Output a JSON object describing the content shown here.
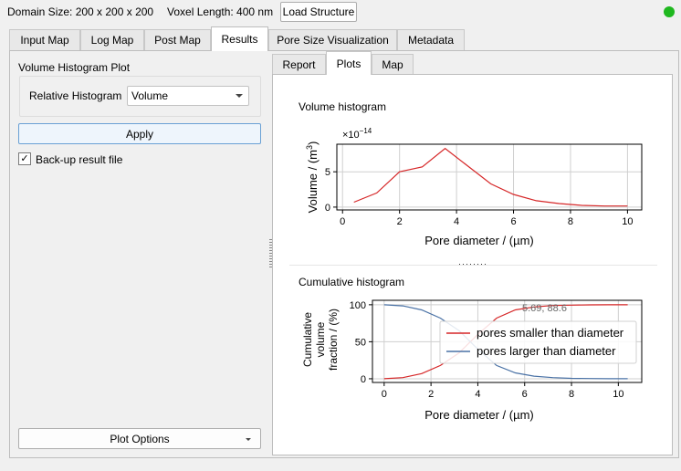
{
  "topbar": {
    "domain_size": "Domain Size: 200 x 200 x 200",
    "voxel_length": "Voxel Length: 400 nm",
    "load_button": "Load Structure",
    "status_color": "#1fb81f"
  },
  "tabs": [
    "Input Map",
    "Log Map",
    "Post Map",
    "Results",
    "Pore Size Visualization",
    "Metadata"
  ],
  "active_tab": "Results",
  "left": {
    "section_title": "Volume Histogram Plot",
    "relative_label": "Relative Histogram",
    "relative_value": "Volume",
    "apply_button": "Apply",
    "backup_checked": true,
    "backup_check_glyph": "✓",
    "backup_label": "Back-up result file",
    "plot_options_button": "Plot Options"
  },
  "subtabs": [
    "Report",
    "Plots",
    "Map"
  ],
  "active_subtab": "Plots",
  "hsplit_dots": "........",
  "chart_data": [
    {
      "type": "line",
      "title": "Volume histogram",
      "xlabel": "Pore diameter / (µm)",
      "ylabel": "Volume / (m³)",
      "ylabel_parts": [
        "Volume / (m",
        "3",
        ")"
      ],
      "offset_text": "×10",
      "offset_exp": "−14",
      "xlim": [
        -0.2,
        10.5
      ],
      "ylim": [
        -0.4,
        8.9
      ],
      "xticks": [
        0,
        2,
        4,
        6,
        8,
        10
      ],
      "yticks": [
        0,
        5
      ],
      "grid": true,
      "series": [
        {
          "color": "#d62728",
          "x": [
            0.4,
            1.2,
            2.0,
            2.8,
            3.6,
            4.4,
            5.2,
            6.0,
            6.8,
            7.6,
            8.4,
            9.2,
            10.0
          ],
          "y": [
            0.7,
            2.0,
            5.0,
            5.7,
            8.3,
            5.8,
            3.3,
            1.8,
            0.9,
            0.5,
            0.25,
            0.15,
            0.15
          ]
        }
      ]
    },
    {
      "type": "line",
      "title": "Cumulative histogram",
      "xlabel": "Pore diameter / (µm)",
      "ylabel_lines": [
        "Cumulative",
        "volume",
        "fraction / (%)"
      ],
      "xlim": [
        -0.5,
        11.0
      ],
      "ylim": [
        -5,
        106
      ],
      "xticks": [
        0,
        2,
        4,
        6,
        8,
        10
      ],
      "yticks": [
        0,
        50,
        100
      ],
      "grid": true,
      "cursor_readout": "5.69, 88.6",
      "legend_position": "center-right",
      "series": [
        {
          "name": "pores smaller than diameter",
          "color": "#d62728",
          "x": [
            0,
            0.8,
            1.6,
            2.4,
            3.2,
            4.0,
            4.8,
            5.6,
            6.4,
            7.2,
            8.0,
            8.8,
            9.6,
            10.4
          ],
          "y": [
            0,
            1.5,
            7,
            18,
            35,
            60,
            82,
            93,
            97,
            99,
            99.5,
            99.8,
            99.9,
            100
          ]
        },
        {
          "name": "pores larger than diameter",
          "color": "#4a72a6",
          "x": [
            0,
            0.8,
            1.6,
            2.4,
            3.2,
            4.0,
            4.8,
            5.6,
            6.4,
            7.2,
            8.0,
            8.8,
            9.6,
            10.4
          ],
          "y": [
            100,
            98.5,
            93,
            82,
            65,
            40,
            18,
            8,
            3.5,
            1.5,
            0.6,
            0.3,
            0.1,
            0
          ]
        }
      ]
    }
  ]
}
